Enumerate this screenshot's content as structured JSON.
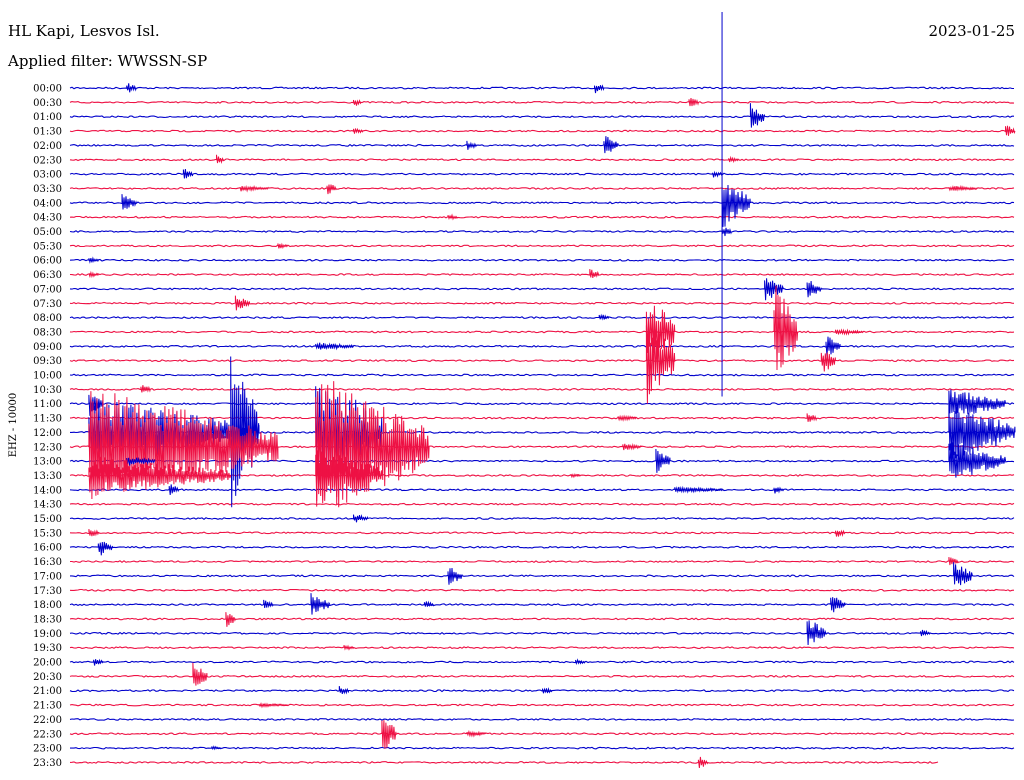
{
  "chart_data": {
    "type": "line",
    "title": "HL Kapi, Lesvos Isl.",
    "date": "2023-01-25",
    "subtitle": "Applied filter: WWSSN-SP",
    "ylabel": "EHZ - 10000",
    "row_labels": [
      "00:00",
      "00:30",
      "01:00",
      "01:30",
      "02:00",
      "02:30",
      "03:00",
      "03:30",
      "04:00",
      "04:30",
      "05:00",
      "05:30",
      "06:00",
      "06:30",
      "07:00",
      "07:30",
      "08:00",
      "08:30",
      "09:00",
      "09:30",
      "10:00",
      "10:30",
      "11:00",
      "11:30",
      "12:00",
      "12:30",
      "13:00",
      "13:30",
      "14:00",
      "14:30",
      "15:00",
      "15:30",
      "16:00",
      "16:30",
      "17:00",
      "17:30",
      "18:00",
      "18:30",
      "19:00",
      "19:30",
      "20:00",
      "20:30",
      "21:00",
      "21:30",
      "22:00",
      "22:30",
      "23:00",
      "23:30"
    ],
    "row_colors": [
      "#0000cc",
      "#ee1144"
    ],
    "minutes_per_row": 30,
    "last_row_end_fraction": 0.92,
    "events": [
      {
        "row": 0,
        "t": 0.06,
        "amp": 6,
        "dur": 0.01
      },
      {
        "row": 0,
        "t": 0.555,
        "amp": 6,
        "dur": 0.01
      },
      {
        "row": 1,
        "t": 0.3,
        "amp": 5,
        "dur": 0.008
      },
      {
        "row": 1,
        "t": 0.655,
        "amp": 7,
        "dur": 0.01
      },
      {
        "row": 2,
        "t": 0.72,
        "amp": 14,
        "dur": 0.015
      },
      {
        "row": 3,
        "t": 0.3,
        "amp": 3,
        "dur": 0.01
      },
      {
        "row": 3,
        "t": 0.99,
        "amp": 7,
        "dur": 0.01
      },
      {
        "row": 4,
        "t": 0.42,
        "amp": 5,
        "dur": 0.01
      },
      {
        "row": 4,
        "t": 0.565,
        "amp": 11,
        "dur": 0.015
      },
      {
        "row": 5,
        "t": 0.155,
        "amp": 5,
        "dur": 0.008
      },
      {
        "row": 5,
        "t": 0.697,
        "amp": 3,
        "dur": 0.01
      },
      {
        "row": 6,
        "t": 0.12,
        "amp": 7,
        "dur": 0.01
      },
      {
        "row": 6,
        "t": 0.68,
        "amp": 4,
        "dur": 0.01
      },
      {
        "row": 7,
        "t": 0.18,
        "amp": 3,
        "dur": 0.03
      },
      {
        "row": 7,
        "t": 0.272,
        "amp": 7,
        "dur": 0.01
      },
      {
        "row": 7,
        "t": 0.93,
        "amp": 3,
        "dur": 0.03
      },
      {
        "row": 8,
        "t": 0.055,
        "amp": 9,
        "dur": 0.015
      },
      {
        "row": 8,
        "t": 0.69,
        "amp": 26,
        "dur": 0.03
      },
      {
        "row": 9,
        "t": 0.4,
        "amp": 3,
        "dur": 0.01
      },
      {
        "row": 10,
        "t": 0.69,
        "amp": 6,
        "dur": 0.01
      },
      {
        "row": 11,
        "t": 0.22,
        "amp": 3,
        "dur": 0.01
      },
      {
        "row": 12,
        "t": 0.02,
        "amp": 3,
        "dur": 0.01
      },
      {
        "row": 13,
        "t": 0.02,
        "amp": 3,
        "dur": 0.01
      },
      {
        "row": 13,
        "t": 0.55,
        "amp": 6,
        "dur": 0.01
      },
      {
        "row": 14,
        "t": 0.735,
        "amp": 14,
        "dur": 0.02
      },
      {
        "row": 14,
        "t": 0.78,
        "amp": 10,
        "dur": 0.015
      },
      {
        "row": 15,
        "t": 0.175,
        "amp": 8,
        "dur": 0.015
      },
      {
        "row": 16,
        "t": 0.56,
        "amp": 4,
        "dur": 0.01
      },
      {
        "row": 17,
        "t": 0.61,
        "amp": 40,
        "dur": 0.03
      },
      {
        "row": 17,
        "t": 0.81,
        "amp": 3,
        "dur": 0.03
      },
      {
        "row": 17,
        "t": 0.745,
        "amp": 50,
        "dur": 0.025
      },
      {
        "row": 18,
        "t": 0.26,
        "amp": 4,
        "dur": 0.04
      },
      {
        "row": 18,
        "t": 0.8,
        "amp": 12,
        "dur": 0.015
      },
      {
        "row": 19,
        "t": 0.61,
        "amp": 45,
        "dur": 0.03
      },
      {
        "row": 19,
        "t": 0.795,
        "amp": 14,
        "dur": 0.015
      },
      {
        "row": 21,
        "t": 0.075,
        "amp": 6,
        "dur": 0.01
      },
      {
        "row": 22,
        "t": 0.02,
        "amp": 14,
        "dur": 0.015
      },
      {
        "row": 22,
        "t": 0.93,
        "amp": 15,
        "dur": 0.06
      },
      {
        "row": 23,
        "t": 0.58,
        "amp": 3,
        "dur": 0.02
      },
      {
        "row": 23,
        "t": 0.78,
        "amp": 6,
        "dur": 0.01
      },
      {
        "row": 24,
        "t": 0.02,
        "amp": 35,
        "dur": 0.18
      },
      {
        "row": 24,
        "t": 0.17,
        "amp": 80,
        "dur": 0.03
      },
      {
        "row": 24,
        "t": 0.26,
        "amp": 60,
        "dur": 0.07
      },
      {
        "row": 24,
        "t": 0.93,
        "amp": 30,
        "dur": 0.07
      },
      {
        "row": 25,
        "t": 0.02,
        "amp": 60,
        "dur": 0.2
      },
      {
        "row": 25,
        "t": 0.26,
        "amp": 75,
        "dur": 0.12
      },
      {
        "row": 25,
        "t": 0.585,
        "amp": 4,
        "dur": 0.02
      },
      {
        "row": 26,
        "t": 0.06,
        "amp": 5,
        "dur": 0.03
      },
      {
        "row": 26,
        "t": 0.62,
        "amp": 14,
        "dur": 0.015
      },
      {
        "row": 26,
        "t": 0.93,
        "amp": 20,
        "dur": 0.06
      },
      {
        "row": 27,
        "t": 0.02,
        "amp": 20,
        "dur": 0.15
      },
      {
        "row": 27,
        "t": 0.26,
        "amp": 30,
        "dur": 0.07
      },
      {
        "row": 27,
        "t": 0.53,
        "amp": 3,
        "dur": 0.01
      },
      {
        "row": 28,
        "t": 0.105,
        "amp": 7,
        "dur": 0.01
      },
      {
        "row": 28,
        "t": 0.64,
        "amp": 3,
        "dur": 0.05
      },
      {
        "row": 28,
        "t": 0.745,
        "amp": 4,
        "dur": 0.01
      },
      {
        "row": 30,
        "t": 0.3,
        "amp": 5,
        "dur": 0.015
      },
      {
        "row": 31,
        "t": 0.02,
        "amp": 5,
        "dur": 0.01
      },
      {
        "row": 31,
        "t": 0.81,
        "amp": 5,
        "dur": 0.01
      },
      {
        "row": 32,
        "t": 0.03,
        "amp": 10,
        "dur": 0.015
      },
      {
        "row": 33,
        "t": 0.93,
        "amp": 5,
        "dur": 0.01
      },
      {
        "row": 34,
        "t": 0.4,
        "amp": 10,
        "dur": 0.015
      },
      {
        "row": 34,
        "t": 0.935,
        "amp": 14,
        "dur": 0.02
      },
      {
        "row": 36,
        "t": 0.205,
        "amp": 5,
        "dur": 0.01
      },
      {
        "row": 36,
        "t": 0.255,
        "amp": 12,
        "dur": 0.02
      },
      {
        "row": 36,
        "t": 0.375,
        "amp": 4,
        "dur": 0.01
      },
      {
        "row": 36,
        "t": 0.805,
        "amp": 11,
        "dur": 0.015
      },
      {
        "row": 37,
        "t": 0.165,
        "amp": 9,
        "dur": 0.01
      },
      {
        "row": 38,
        "t": 0.78,
        "amp": 16,
        "dur": 0.02
      },
      {
        "row": 38,
        "t": 0.9,
        "amp": 4,
        "dur": 0.01
      },
      {
        "row": 39,
        "t": 0.29,
        "amp": 3,
        "dur": 0.01
      },
      {
        "row": 40,
        "t": 0.025,
        "amp": 4,
        "dur": 0.01
      },
      {
        "row": 40,
        "t": 0.535,
        "amp": 3,
        "dur": 0.01
      },
      {
        "row": 41,
        "t": 0.13,
        "amp": 14,
        "dur": 0.015
      },
      {
        "row": 42,
        "t": 0.285,
        "amp": 5,
        "dur": 0.01
      },
      {
        "row": 42,
        "t": 0.5,
        "amp": 4,
        "dur": 0.01
      },
      {
        "row": 43,
        "t": 0.2,
        "amp": 2,
        "dur": 0.03
      },
      {
        "row": 45,
        "t": 0.33,
        "amp": 20,
        "dur": 0.015
      },
      {
        "row": 45,
        "t": 0.42,
        "amp": 3,
        "dur": 0.02
      },
      {
        "row": 46,
        "t": 0.15,
        "amp": 2,
        "dur": 0.01
      },
      {
        "row": 47,
        "t": 0.665,
        "amp": 7,
        "dur": 0.01
      }
    ]
  }
}
